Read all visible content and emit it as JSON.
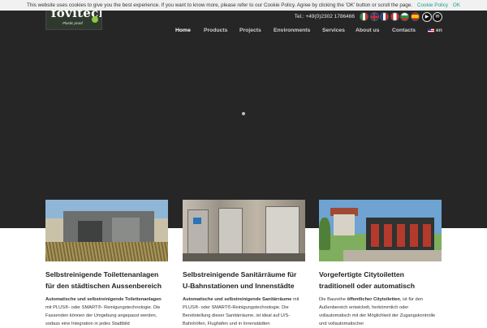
{
  "cookie": {
    "text": "This website uses cookies to give you the best experience. If you want to know more, please refer to our Cookie Policy. Agree by clicking the 'OK' button or scroll the page.",
    "policy_link": "Cookie Policy",
    "ok_label": "OK"
  },
  "header": {
    "logo_text": "fovitech",
    "logo_sub": "Plastic proof",
    "phone": "Tel.: +49(0)2302 1786466",
    "flags": [
      "italian-flag-icon",
      "uk-flag-icon",
      "french-flag-icon",
      "canadian-flag-icon",
      "bulgarian-flag-icon",
      "spanish-flag-icon"
    ],
    "social": [
      "youtube-icon",
      "mail-icon"
    ],
    "language": "en"
  },
  "nav": {
    "items": [
      "Home",
      "Products",
      "Projects",
      "Environments",
      "Services",
      "About us",
      "Contacts"
    ],
    "active": "Home"
  },
  "cards": [
    {
      "title": "Selbstreinigende Toilettenanlagen für den städtischen Aussenbereich",
      "text_bold": "Automatische und selbstreinigende Toilettenanlagen",
      "text": " mit PLUS®- oder SMART®- Reinigungstechnologie. Die Fassenden können der Umgebung angepasst werden, sodass eine Integration in jedes Stadtbild"
    },
    {
      "title": "Selbstreinigende Sanitärräume für U-Bahnstationen und Innenstädte",
      "text_bold": "Automatische und selbstreinigende Sanitärräume",
      "text": " mit PLUS®- oder SMART®-Reinigungstechnologie. Die Bereitstellung dieser Sanitärräume, ist ideal auf U/S-Bahnhöfen, Flughäfen und in Innenstädten"
    },
    {
      "title": "Vorgefertigte Citytoiletten traditionell oder automatisch",
      "text_prefix": "Die Baureihe ",
      "text_bold": "öffentlicher Citytoiletten",
      "text": ", ist für den Außenbereich entwickelt, herkömmlich oder vollautomatisch mit der Möglichkeit der Zugangskontrolle und vollautomatischer"
    }
  ],
  "colors": {
    "header_bg": "#262626",
    "cookie_link": "#1a9c8f",
    "nav_text": "#cfcfcf"
  }
}
